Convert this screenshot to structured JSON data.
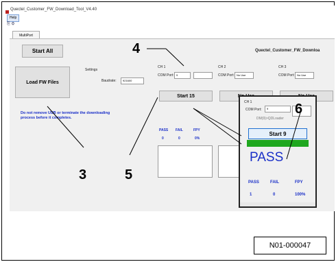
{
  "window": {
    "title": "Quectel_Customer_FW_Download_Tool_V4.40",
    "menu_help": "Help",
    "tab_label": "MultiPort",
    "brand": "Quectel_Customer_FW_Downloa"
  },
  "controls": {
    "start_all": "Start All",
    "load_fw": "Load FW Files",
    "settings": "Settings",
    "baudrate_label": "Baudrate:",
    "baudrate_value": "921600",
    "warning": "Do not remove USB or terminate the downloading process before it completes."
  },
  "channels": [
    {
      "name": "CH 1",
      "com_label": "COM Port:",
      "com_value": "9",
      "button": "Start 15",
      "pass": "0",
      "fail": "0",
      "fpy": "0%"
    },
    {
      "name": "CH 2",
      "com_label": "COM Port:",
      "com_value": "No Use",
      "button": "No Use"
    },
    {
      "name": "CH 3",
      "com_label": "COM Port:",
      "com_value": "No Use",
      "button": "No Use"
    }
  ],
  "stats_headers": {
    "pass": "PASS",
    "fail": "FAIL",
    "fpy": "FPY"
  },
  "popup": {
    "name": "CH 1",
    "com_label": "COM Port:",
    "com_value": "9",
    "device": "DM(9)>QDLoader",
    "button": "Start 9",
    "result": "PASS",
    "pass": "1",
    "fail": "0",
    "fpy": "100%"
  },
  "callouts": {
    "c3": "3",
    "c4": "4",
    "c5": "5",
    "c6": "6"
  },
  "figure_code": "N01-000047",
  "colors": {
    "progress": "#1fa71f",
    "status_blue": "#1a2fc8"
  }
}
